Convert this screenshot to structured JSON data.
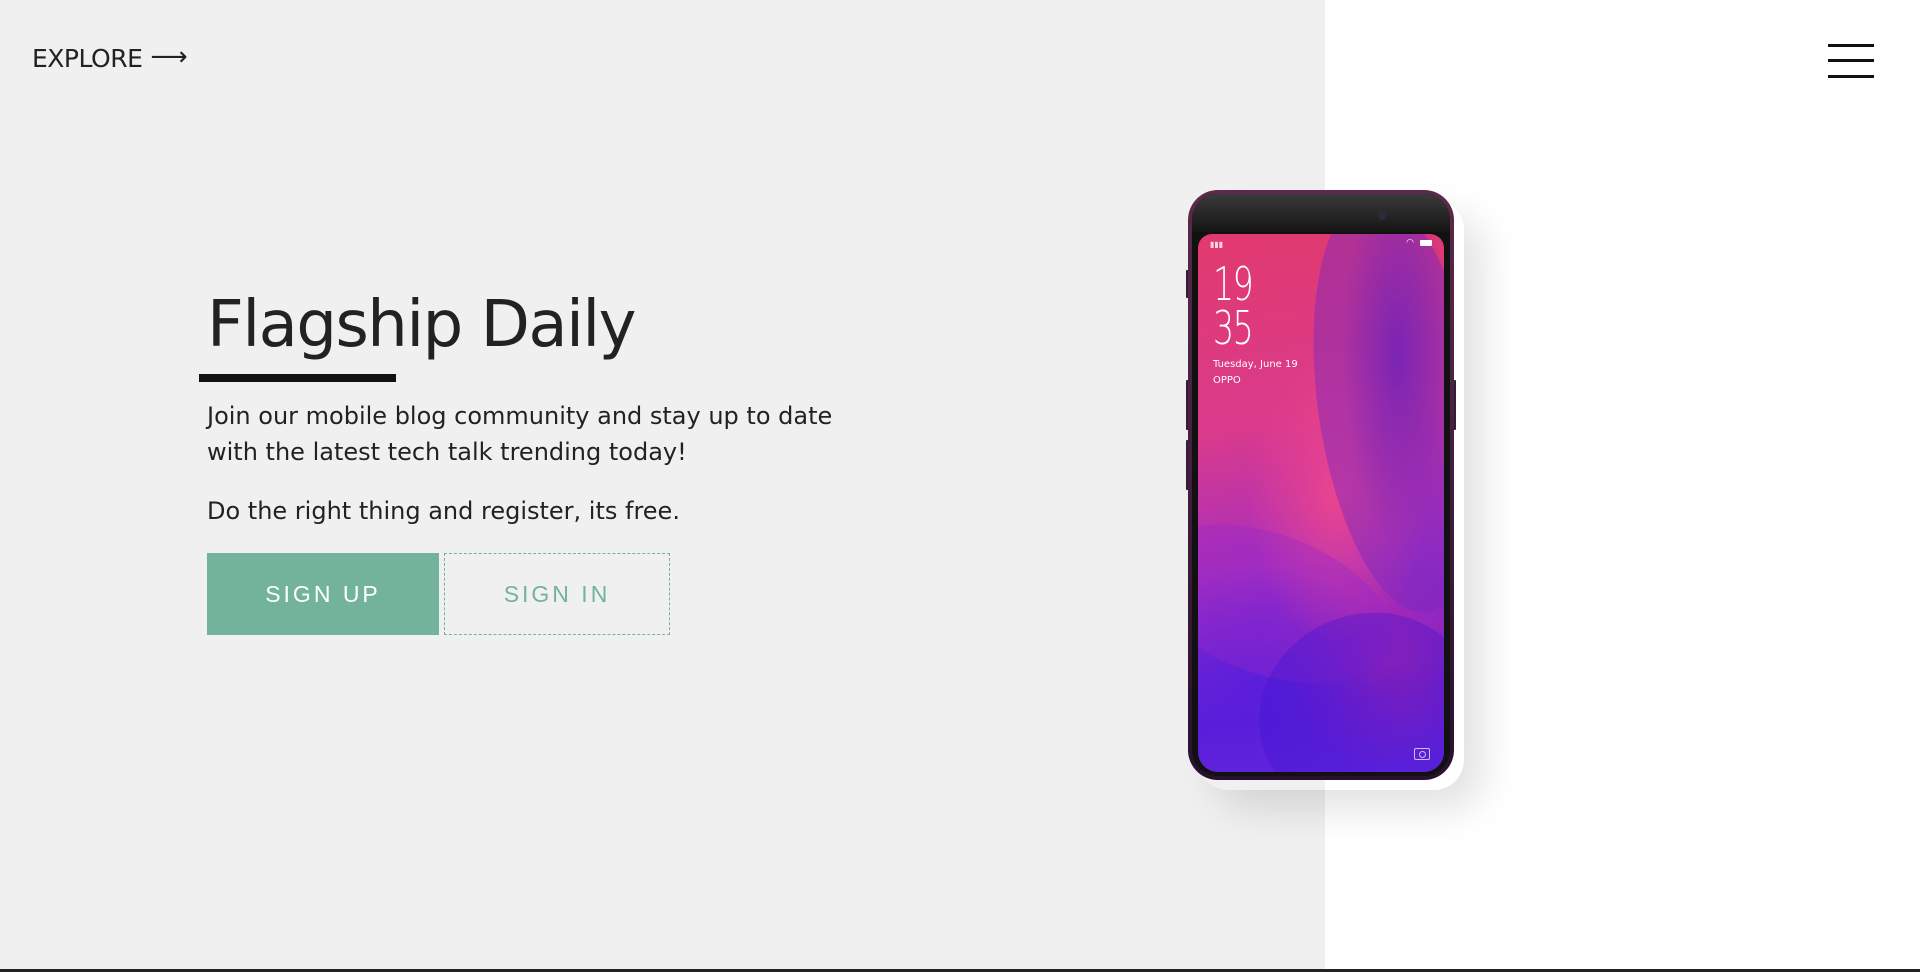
{
  "nav": {
    "explore_label": "EXPLORE",
    "explore_arrow": "⟶",
    "menu_icon": "hamburger-menu-icon"
  },
  "hero": {
    "title": "Flagship Daily",
    "description": "Join our mobile blog community and stay up to date with the latest tech talk trending today!",
    "note": "Do the right thing and register, its free.",
    "signup_label": "SIGN UP",
    "signin_label": "SIGN IN"
  },
  "phone": {
    "clock_hour": "19",
    "clock_minute": "35",
    "date": "Tuesday, June 19",
    "carrier": "OPPO"
  },
  "colors": {
    "left_panel_bg": "#f0f0f0",
    "right_panel_bg": "#ffffff",
    "accent_green": "#73b39c",
    "text_dark": "#222222"
  }
}
